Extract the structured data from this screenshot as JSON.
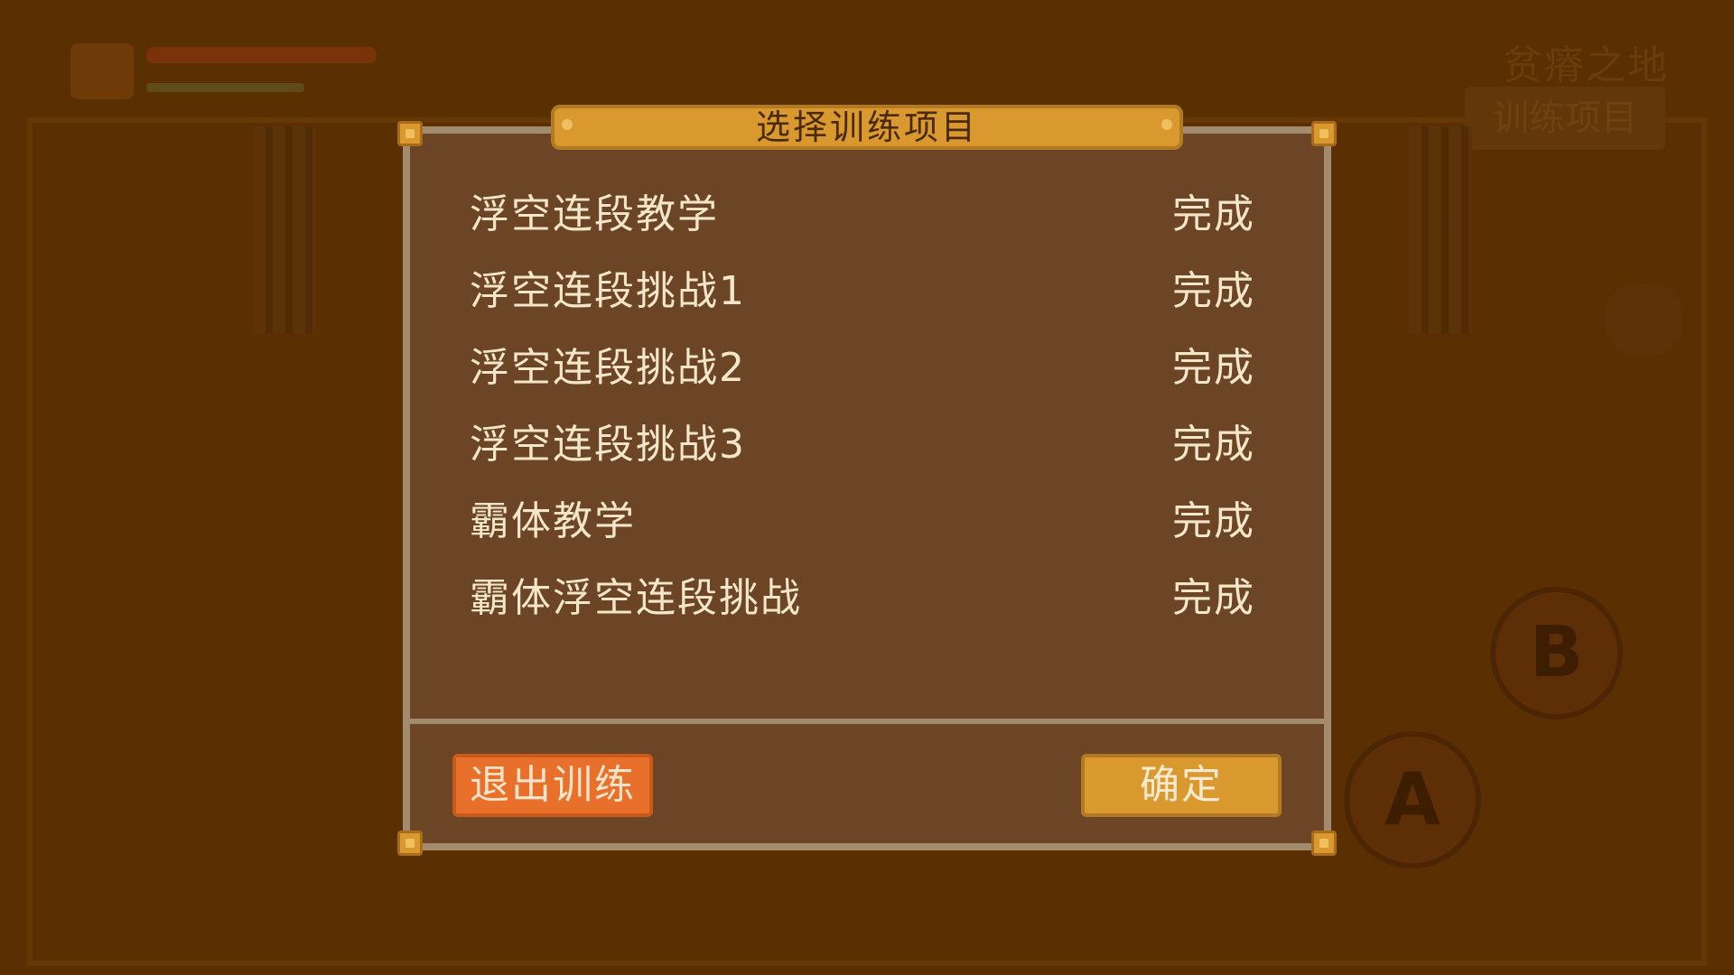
{
  "background": {
    "area_name": "贫瘠之地",
    "area_button": "训练项目",
    "b_button": "B",
    "a_button": "A"
  },
  "dialog": {
    "title": "选择训练项目",
    "items": [
      {
        "name": "浮空连段教学",
        "status": "完成"
      },
      {
        "name": "浮空连段挑战1",
        "status": "完成"
      },
      {
        "name": "浮空连段挑战2",
        "status": "完成"
      },
      {
        "name": "浮空连段挑战3",
        "status": "完成"
      },
      {
        "name": "霸体教学",
        "status": "完成"
      },
      {
        "name": "霸体浮空连段挑战",
        "status": "完成"
      }
    ],
    "exit_label": "退出训练",
    "confirm_label": "确定"
  },
  "colors": {
    "panel": "#6b4526",
    "panel_border": "#a28c6d",
    "accent_gold": "#d9992f",
    "exit_orange": "#e8702a",
    "text": "#f4e6c8"
  }
}
